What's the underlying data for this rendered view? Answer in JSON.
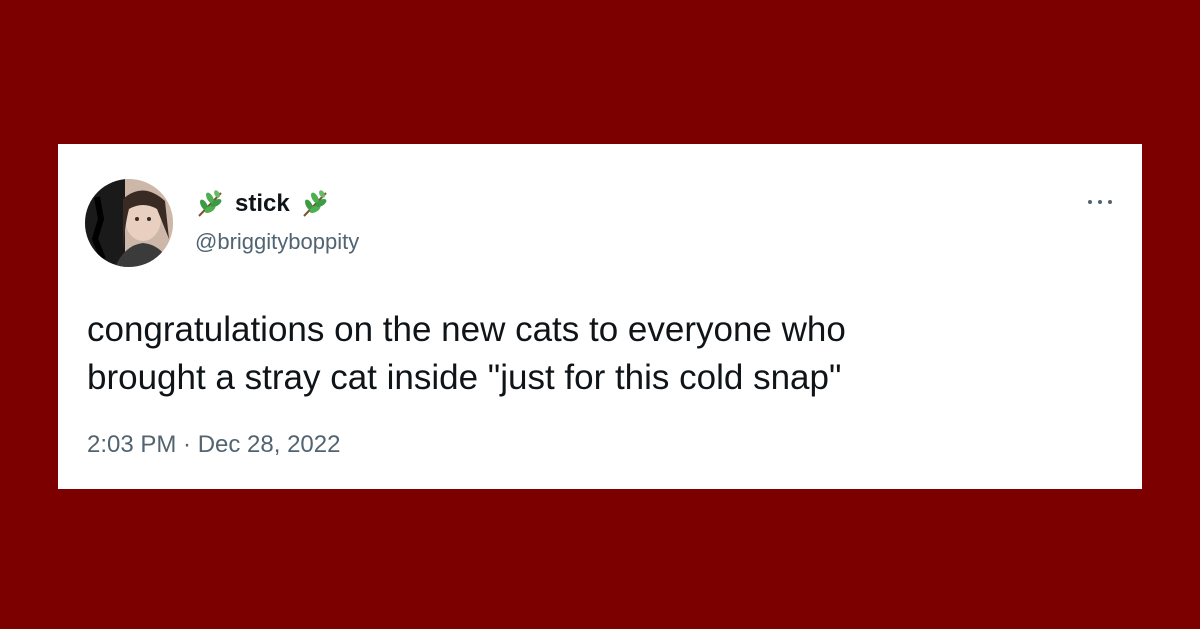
{
  "tweet": {
    "display_name": "stick",
    "handle": "@briggityboppity",
    "text": "congratulations on the new cats to everyone who\nbrought a stray cat inside \"just for this cold snap\"",
    "timestamp": "2:03 PM · Dec 28, 2022",
    "name_emoji_icon": "herb-icon",
    "more_icon": "more-horizontal-icon"
  },
  "colors": {
    "background": "#7d0000",
    "card": "#ffffff",
    "text_primary": "#0f1419",
    "text_secondary": "#536471",
    "herb_green": "#4caf50"
  }
}
